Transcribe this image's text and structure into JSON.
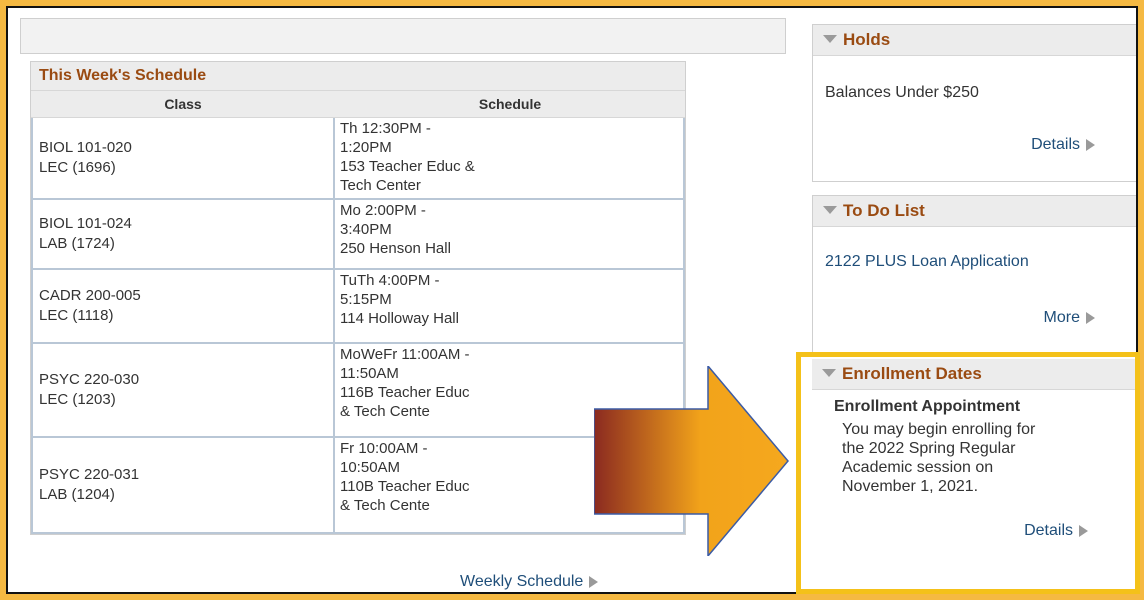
{
  "schedule": {
    "title": "This Week's Schedule",
    "headers": {
      "class": "Class",
      "schedule": "Schedule"
    },
    "rows": [
      {
        "class": "BIOL 101-020\nLEC (1696)",
        "schedule": "Th 12:30PM -\n1:20PM\n153 Teacher Educ &\nTech Center"
      },
      {
        "class": "BIOL 101-024\nLAB (1724)",
        "schedule": "Mo 2:00PM -\n3:40PM\n250 Henson Hall"
      },
      {
        "class": "CADR 200-005\nLEC (1118)",
        "schedule": "TuTh 4:00PM -\n5:15PM\n114 Holloway Hall"
      },
      {
        "class": "PSYC 220-030\nLEC (1203)",
        "schedule": "MoWeFr 11:00AM -\n11:50AM\n116B Teacher Educ\n& Tech Cente"
      },
      {
        "class": "PSYC 220-031\nLAB (1204)",
        "schedule": "Fr 10:00AM -\n10:50AM\n110B Teacher Educ\n& Tech Cente"
      }
    ],
    "weekly_link": "Weekly Schedule"
  },
  "holds": {
    "title": "Holds",
    "item": "Balances Under $250",
    "link": "Details"
  },
  "todo": {
    "title": "To Do List",
    "item": "2122 PLUS Loan Application",
    "link": "More"
  },
  "enrollment": {
    "title": "Enrollment Dates",
    "subtitle": "Enrollment Appointment",
    "text": "You may begin enrolling for\nthe 2022 Spring Regular\nAcademic session on\nNovember 1, 2021.",
    "link": "Details"
  },
  "colors": {
    "background": "#f5b942",
    "highlight": "#f4c119",
    "heading": "#9a4b12",
    "link": "#1f4e79",
    "arrow_start": "#8b2a20",
    "arrow_end": "#f2a31a"
  },
  "icons": {
    "collapse": "triangle-down-icon",
    "link_arrow": "triangle-right-icon",
    "callout": "right-arrow-graphic"
  }
}
